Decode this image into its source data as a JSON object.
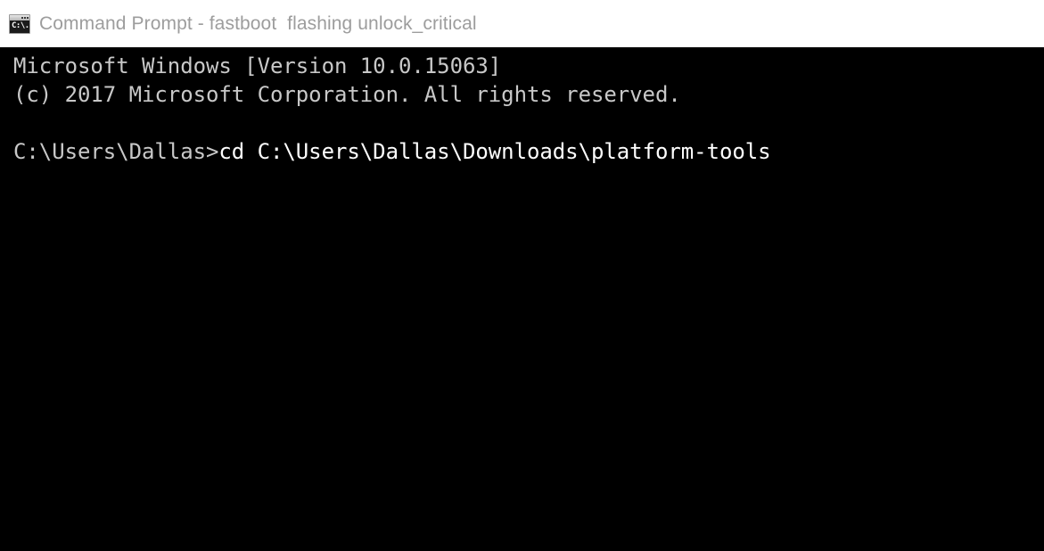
{
  "window": {
    "title": "Command Prompt - fastboot  flashing unlock_critical",
    "icon": "command-prompt-icon",
    "icon_glyph": "C:\\.",
    "title_bar_bg": "#ffffff",
    "title_text_color": "#9d9d9d"
  },
  "console": {
    "background": "#000000",
    "foreground": "#c8c8c8",
    "command_color": "#ffffff",
    "lines": [
      {
        "id": "version-line",
        "text": "Microsoft Windows [Version 10.0.15063]"
      },
      {
        "id": "copyright-line",
        "text": "(c) 2017 Microsoft Corporation. All rights reserved."
      },
      {
        "id": "blank-line",
        "text": " "
      }
    ],
    "prompt_line": {
      "prompt": "C:\\Users\\Dallas>",
      "command": "cd C:\\Users\\Dallas\\Downloads\\platform-tools"
    }
  }
}
